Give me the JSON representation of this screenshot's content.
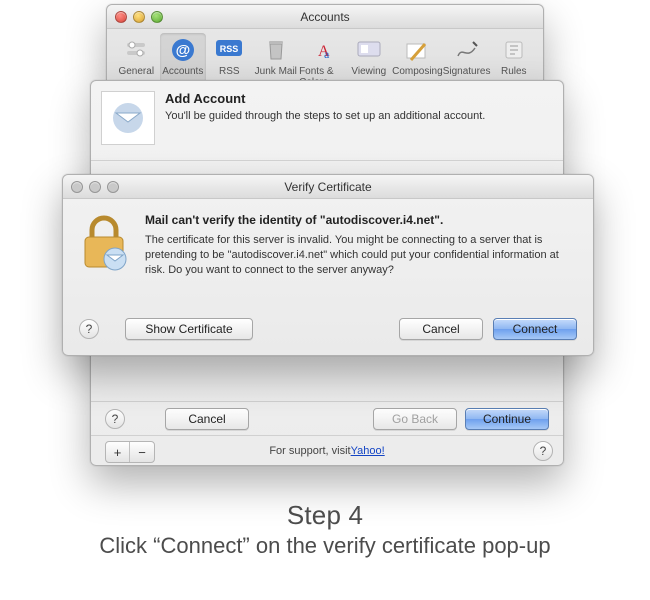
{
  "accounts_window": {
    "title": "Accounts",
    "toolbar": [
      {
        "id": "general",
        "label": "General",
        "icon": "switches-icon"
      },
      {
        "id": "accounts",
        "label": "Accounts",
        "icon": "at-icon",
        "selected": true
      },
      {
        "id": "rss",
        "label": "RSS",
        "icon": "rss-icon"
      },
      {
        "id": "junk",
        "label": "Junk Mail",
        "icon": "trash-icon"
      },
      {
        "id": "fonts",
        "label": "Fonts & Colors",
        "icon": "fonts-icon"
      },
      {
        "id": "viewing",
        "label": "Viewing",
        "icon": "eye-icon"
      },
      {
        "id": "composing",
        "label": "Composing",
        "icon": "pencil-icon"
      },
      {
        "id": "signatures",
        "label": "Signatures",
        "icon": "signature-icon"
      },
      {
        "id": "rules",
        "label": "Rules",
        "icon": "rules-icon"
      }
    ]
  },
  "add_account_sheet": {
    "heading": "Add Account",
    "subtext": "You'll be guided through the steps to set up an additional account.",
    "help_row": {
      "cancel": "Cancel",
      "go_back": "Go Back",
      "continue": "Continue"
    },
    "footer_prefix": "For support, visit ",
    "footer_link_text": "Yahoo!",
    "plus": "+",
    "minus": "−"
  },
  "verify_dialog": {
    "title": "Verify Certificate",
    "headline": "Mail can't verify the identity of \"autodiscover.i4.net\".",
    "body": "The certificate for this server is invalid. You might be connecting to a server that is pretending to be \"autodiscover.i4.net\" which could put your confidential information at risk. Do you want to connect to the server anyway?",
    "show_certificate": "Show Certificate",
    "cancel": "Cancel",
    "connect": "Connect"
  },
  "caption": {
    "step": "Step 4",
    "desc": "Click “Connect” on the verify certificate pop-up"
  }
}
